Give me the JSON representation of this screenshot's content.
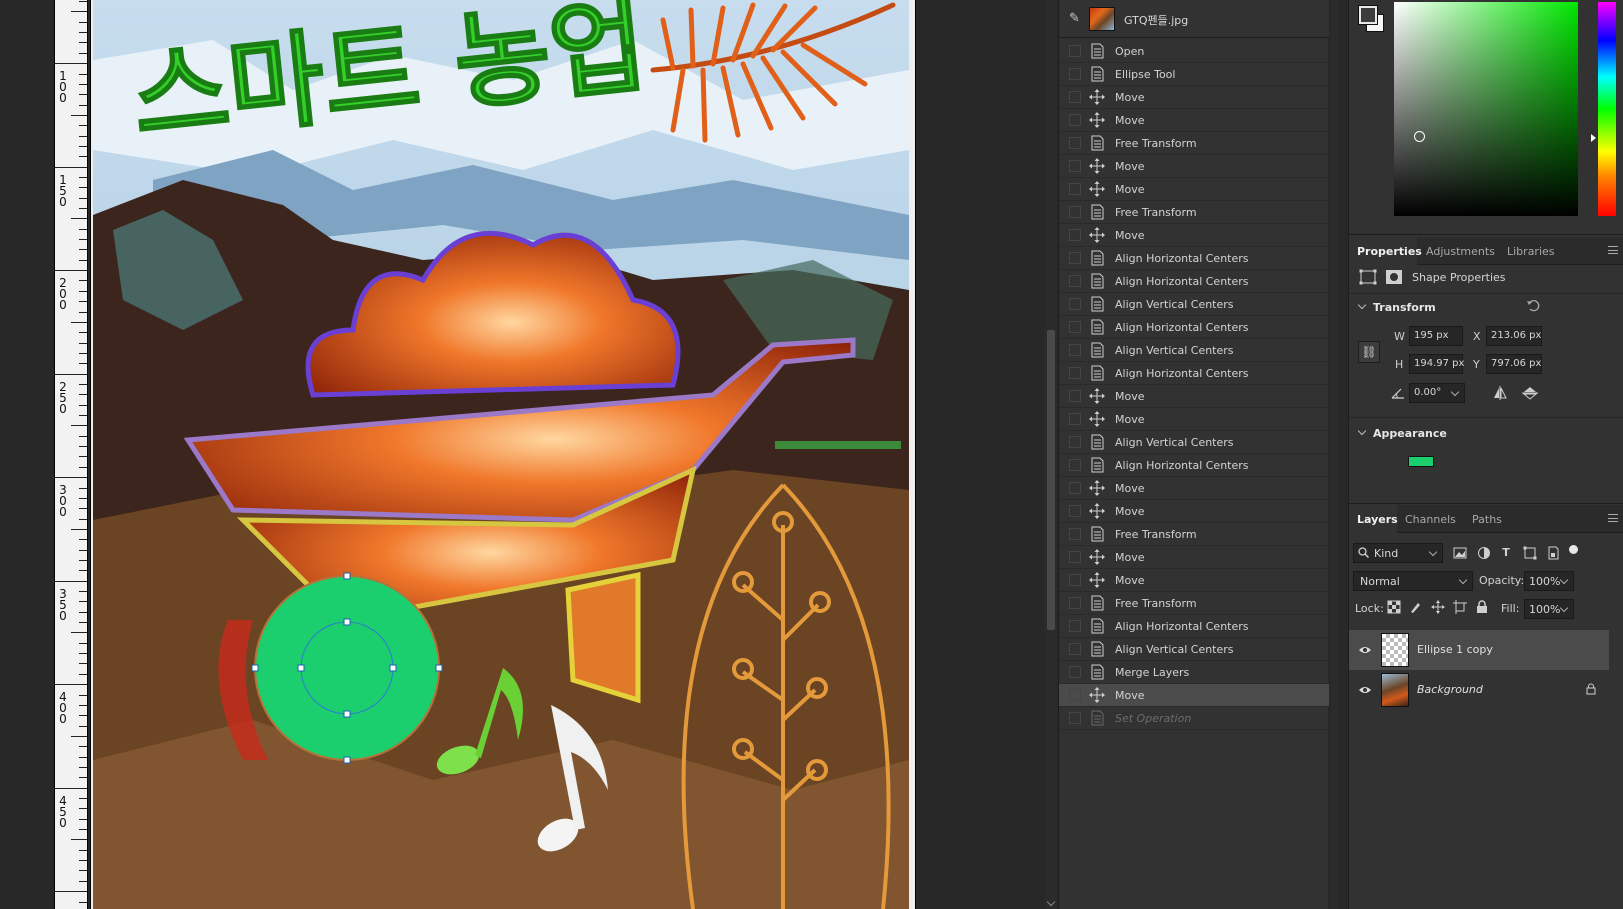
{
  "document": {
    "title": "GTQ펜들.jpg"
  },
  "artwork": {
    "headline": "스마트 농업"
  },
  "ruler": {
    "labels": [
      "100",
      "150",
      "200",
      "250",
      "300",
      "350",
      "400",
      "450"
    ]
  },
  "history": {
    "items": [
      {
        "label": "Open",
        "icon": "document-icon"
      },
      {
        "label": "Ellipse Tool",
        "icon": "document-icon"
      },
      {
        "label": "Move",
        "icon": "move-icon"
      },
      {
        "label": "Move",
        "icon": "move-icon"
      },
      {
        "label": "Free Transform",
        "icon": "document-icon"
      },
      {
        "label": "Move",
        "icon": "move-icon"
      },
      {
        "label": "Move",
        "icon": "move-icon"
      },
      {
        "label": "Free Transform",
        "icon": "document-icon"
      },
      {
        "label": "Move",
        "icon": "move-icon"
      },
      {
        "label": "Align Horizontal Centers",
        "icon": "document-icon"
      },
      {
        "label": "Align Horizontal Centers",
        "icon": "document-icon"
      },
      {
        "label": "Align Vertical Centers",
        "icon": "document-icon"
      },
      {
        "label": "Align Horizontal Centers",
        "icon": "document-icon"
      },
      {
        "label": "Align Vertical Centers",
        "icon": "document-icon"
      },
      {
        "label": "Align Horizontal Centers",
        "icon": "document-icon"
      },
      {
        "label": "Move",
        "icon": "move-icon"
      },
      {
        "label": "Move",
        "icon": "move-icon"
      },
      {
        "label": "Align Vertical Centers",
        "icon": "document-icon"
      },
      {
        "label": "Align Horizontal Centers",
        "icon": "document-icon"
      },
      {
        "label": "Move",
        "icon": "move-icon"
      },
      {
        "label": "Move",
        "icon": "move-icon"
      },
      {
        "label": "Free Transform",
        "icon": "document-icon"
      },
      {
        "label": "Move",
        "icon": "move-icon"
      },
      {
        "label": "Move",
        "icon": "move-icon"
      },
      {
        "label": "Free Transform",
        "icon": "document-icon"
      },
      {
        "label": "Align Horizontal Centers",
        "icon": "document-icon"
      },
      {
        "label": "Align Vertical Centers",
        "icon": "document-icon"
      },
      {
        "label": "Merge Layers",
        "icon": "document-icon"
      },
      {
        "label": "Move",
        "icon": "move-icon",
        "active": true
      },
      {
        "label": "Set Operation",
        "icon": "document-icon",
        "disabled": true
      }
    ]
  },
  "properties": {
    "tabs": [
      "Properties",
      "Adjustments",
      "Libraries"
    ],
    "active_tab": "Properties",
    "shape_label": "Shape Properties",
    "transform_heading": "Transform",
    "appearance_heading": "Appearance",
    "w_label": "W",
    "h_label": "H",
    "x_label": "X",
    "y_label": "Y",
    "w": "195 px",
    "h": "194.97 px",
    "x": "213.06 px",
    "y": "797.06 px",
    "angle": "0.00°",
    "fill_color": "#1ccf6e"
  },
  "layers": {
    "tabs": [
      "Layers",
      "Channels",
      "Paths"
    ],
    "active_tab": "Layers",
    "filter_kind": "Kind",
    "blend_mode": "Normal",
    "opacity_label": "Opacity:",
    "opacity": "100%",
    "lock_label": "Lock:",
    "fill_label": "Fill:",
    "fill": "100%",
    "items": [
      {
        "name": "Ellipse 1 copy",
        "selected": true
      },
      {
        "name": "Background",
        "locked": true
      }
    ]
  },
  "colors": {
    "accent_green": "#1ccf6e",
    "panel_bg": "#323232",
    "active_row": "#4b4b4b"
  }
}
